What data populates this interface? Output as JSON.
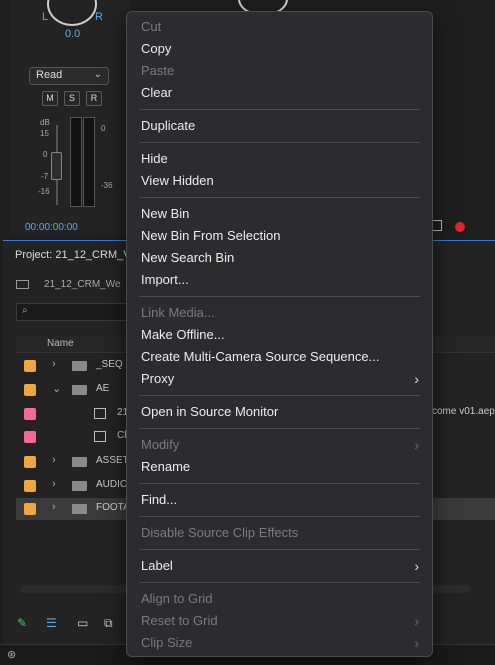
{
  "audio_mixer": {
    "pan_left": "L",
    "pan_right": "R",
    "pan_value": "0.0",
    "automation_mode": "Read",
    "mute": "M",
    "solo": "S",
    "record": "R",
    "db_unit": "dB",
    "scale_left": [
      "15",
      "0",
      "-7",
      "-16"
    ],
    "scale_right": [
      "0",
      "-36"
    ],
    "timecode": "00:00:00:00"
  },
  "project_panel": {
    "title": "Project: 21_12_CRM_V",
    "bin_path": "21_12_CRM_We",
    "column_name": "Name",
    "rows": [
      {
        "label": "_SEQ",
        "color": "#f0a640"
      },
      {
        "label": "AE",
        "color": "#f0a640"
      },
      {
        "label": "21",
        "color": "#f2689a"
      },
      {
        "label": "Cl",
        "color": "#f2689a"
      },
      {
        "label": "ASSET",
        "color": "#f0a640"
      },
      {
        "label": "AUDIC",
        "color": "#f0a640"
      },
      {
        "label": "FOOTA",
        "color": "#f0a640"
      }
    ],
    "trailing_text": "come v01.aep"
  },
  "context_menu": {
    "cut": "Cut",
    "copy": "Copy",
    "paste": "Paste",
    "clear": "Clear",
    "duplicate": "Duplicate",
    "hide": "Hide",
    "view_hidden": "View Hidden",
    "new_bin": "New Bin",
    "new_bin_from_selection": "New Bin From Selection",
    "new_search_bin": "New Search Bin",
    "import": "Import...",
    "link_media": "Link Media...",
    "make_offline": "Make Offline...",
    "create_multicam": "Create Multi-Camera Source Sequence...",
    "proxy": "Proxy",
    "open_in_source_monitor": "Open in Source Monitor",
    "modify": "Modify",
    "rename": "Rename",
    "find": "Find...",
    "disable_source_clip_effects": "Disable Source Clip Effects",
    "label": "Label",
    "align_to_grid": "Align to Grid",
    "reset_to_grid": "Reset to Grid",
    "clip_size": "Clip Size",
    "chevron": "›"
  },
  "icons": {
    "record": "record-dot-icon",
    "export": "export-frame-icon",
    "search": "search-icon",
    "pencil": "pencil-icon",
    "list_view": "list-view-icon",
    "icon_view": "icon-view-icon",
    "creative_cloud": "creative-cloud-icon"
  },
  "colors": {
    "accent_blue": "#5fa8e6",
    "record_red": "#e0262b",
    "label_orange": "#f0a640",
    "label_pink": "#f2689a"
  }
}
